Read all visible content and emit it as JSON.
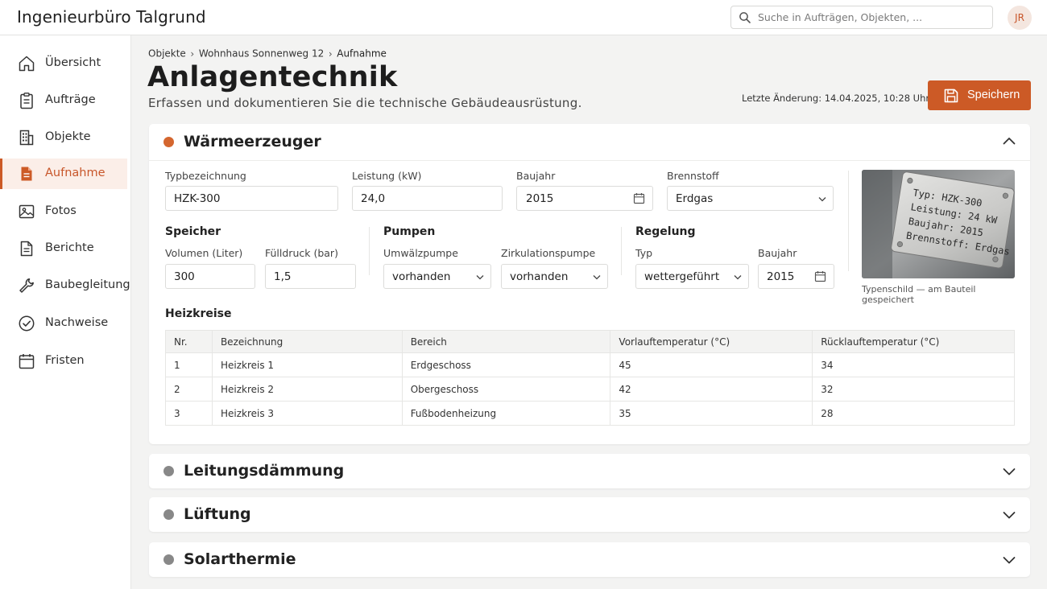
{
  "app": {
    "title": "Ingenieurbüro Talgrund"
  },
  "search": {
    "placeholder": "Suche in Aufträgen, Objekten, ..."
  },
  "user": {
    "initials": "JR"
  },
  "sidebar": {
    "items": [
      {
        "label": "Übersicht",
        "icon": "home-icon"
      },
      {
        "label": "Aufträge",
        "icon": "clipboard-icon"
      },
      {
        "label": "Objekte",
        "icon": "building-icon"
      },
      {
        "label": "Aufnahme",
        "icon": "document-icon",
        "active": true
      },
      {
        "label": "Fotos",
        "icon": "image-icon"
      },
      {
        "label": "Berichte",
        "icon": "report-icon"
      },
      {
        "label": "Baubegleitung",
        "icon": "wrench-icon"
      },
      {
        "label": "Nachweise",
        "icon": "check-circle-icon"
      },
      {
        "label": "Fristen",
        "icon": "calendar-icon"
      }
    ]
  },
  "breadcrumb": [
    "Objekte",
    "Wohnhaus Sonnenweg 12",
    "Aufnahme"
  ],
  "page": {
    "title": "Anlagentechnik",
    "subtitle": "Erfassen und dokumentieren Sie die technische Gebäudeausrüstung.",
    "last_change": "Letzte Änderung: 14.04.2025, 10:28 Uhr",
    "save_label": "Speichern"
  },
  "colors": {
    "accent": "#cc5a26",
    "accent_light": "#fbeee8",
    "inactive_dot": "#888888"
  },
  "sections": {
    "waermeerzeuger": {
      "title": "Wärmeerzeuger",
      "typ": {
        "label": "Typbezeichnung",
        "value": "HZK-300"
      },
      "leistung": {
        "label": "Leistung (kW)",
        "value": "24,0"
      },
      "baujahr": {
        "label": "Baujahr",
        "value": "2015"
      },
      "brennstoff": {
        "label": "Brennstoff",
        "value": "Erdgas"
      },
      "speicher": {
        "title": "Speicher",
        "volumen": {
          "label": "Volumen (Liter)",
          "value": "300"
        },
        "fuelldruck": {
          "label": "Fülldruck (bar)",
          "value": "1,5"
        }
      },
      "pumpen": {
        "title": "Pumpen",
        "umwaelz": {
          "label": "Umwälzpumpe",
          "value": "vorhanden"
        },
        "zirkulation": {
          "label": "Zirkulationspumpe",
          "value": "vorhanden"
        }
      },
      "regelung": {
        "title": "Regelung",
        "typ": {
          "label": "Typ",
          "value": "wettergeführt"
        },
        "baujahr": {
          "label": "Baujahr",
          "value": "2015"
        }
      },
      "photo": {
        "plate_lines": [
          "Typ:  HZK-300",
          "Leistung:  24 kW",
          "Baujahr:  2015",
          "Brennstoff:  Erdgas"
        ],
        "caption": "Typenschild — am Bauteil gespeichert"
      },
      "heizkreise": {
        "title": "Heizkreise",
        "columns": [
          "Nr.",
          "Bezeichnung",
          "Bereich",
          "Vorlauftemperatur (°C)",
          "Rücklauftemperatur (°C)"
        ],
        "rows": [
          [
            "1",
            "Heizkreis 1",
            "Erdgeschoss",
            "45",
            "34"
          ],
          [
            "2",
            "Heizkreis 2",
            "Obergeschoss",
            "42",
            "32"
          ],
          [
            "3",
            "Heizkreis 3",
            "Fußbodenheizung",
            "35",
            "28"
          ]
        ]
      }
    },
    "collapsed": [
      {
        "title": "Leitungsdämmung"
      },
      {
        "title": "Lüftung"
      },
      {
        "title": "Solarthermie"
      }
    ]
  }
}
